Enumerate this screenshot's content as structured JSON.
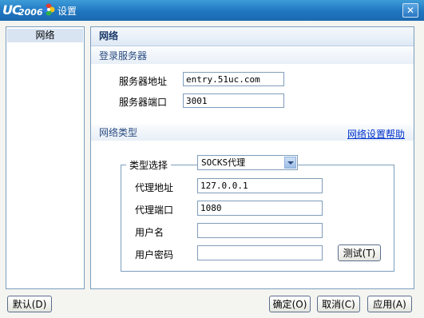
{
  "titlebar": {
    "logo_text": "UC",
    "logo_sub": "2006",
    "title": "设置",
    "close_symbol": "✕"
  },
  "nav": {
    "items": [
      {
        "label": "网络"
      }
    ]
  },
  "panel": {
    "header": "网络",
    "login_section": {
      "title": "登录服务器",
      "server_address_label": "服务器地址",
      "server_address_value": "entry.51uc.com",
      "server_port_label": "服务器端口",
      "server_port_value": "3001"
    },
    "network_section": {
      "title": "网络类型",
      "help_link": "网络设置帮助",
      "type_label": "类型选择",
      "type_value": "SOCKS代理",
      "proxy_address_label": "代理地址",
      "proxy_address_value": "127.0.0.1",
      "proxy_port_label": "代理端口",
      "proxy_port_value": "1080",
      "username_label": "用户名",
      "username_value": "",
      "password_label": "用户密码",
      "password_value": "",
      "test_button": "测试(T)"
    }
  },
  "footer": {
    "default_button": "默认(D)",
    "ok_button": "确定(O)",
    "cancel_button": "取消(C)",
    "apply_button": "应用(A)"
  }
}
